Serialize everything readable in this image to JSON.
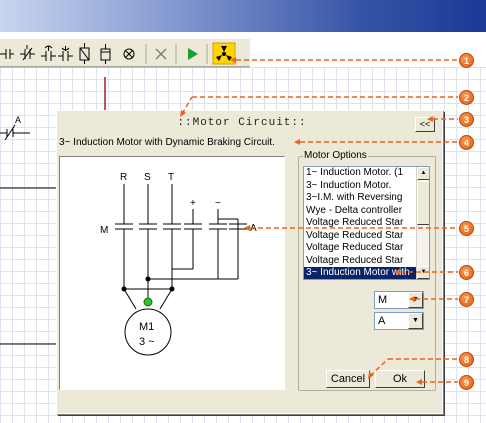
{
  "toolbar": {
    "icons": [
      "contact-no-icon",
      "contact-nc-icon",
      "contact-timer-icon",
      "coil-icon",
      "lamp-icon",
      "fuse-icon",
      "motor-icon",
      "delete-icon",
      "run-icon",
      "fan-icon"
    ],
    "colors": {
      "run": "#1aa030",
      "fan_bg": "#ffd400",
      "delete": "#808080"
    }
  },
  "canvas": {
    "contact_label": "A"
  },
  "dialog": {
    "title": "::Motor Circuit::",
    "collapse_label": "<<",
    "subtitle": "3~ Induction Motor with Dynamic Braking Circuit.",
    "options_label": "Motor Options",
    "options": [
      "1~  Induction Motor. (1",
      "3~  Induction Motor.",
      "3~I.M. with Reversing",
      "Wye - Delta controller",
      "Voltage Reduced Star",
      "Voltage Reduced Star",
      "Voltage Reduced Star",
      "Voltage Reduced Star",
      "3~ Induction Motor with"
    ],
    "selected_index": 8,
    "combo1": "M",
    "combo2": "A",
    "cancel": "Cancel",
    "ok": "Ok"
  },
  "circuit": {
    "phases": [
      "R",
      "S",
      "T"
    ],
    "contactor_label": "M",
    "aux_label": "A",
    "plus": "+",
    "minus": "−",
    "motor_name": "M1",
    "motor_type": "3 ~"
  },
  "callouts": [
    "1",
    "2",
    "3",
    "4",
    "5",
    "6",
    "7",
    "8",
    "9"
  ],
  "callout_color": "#e8661a"
}
